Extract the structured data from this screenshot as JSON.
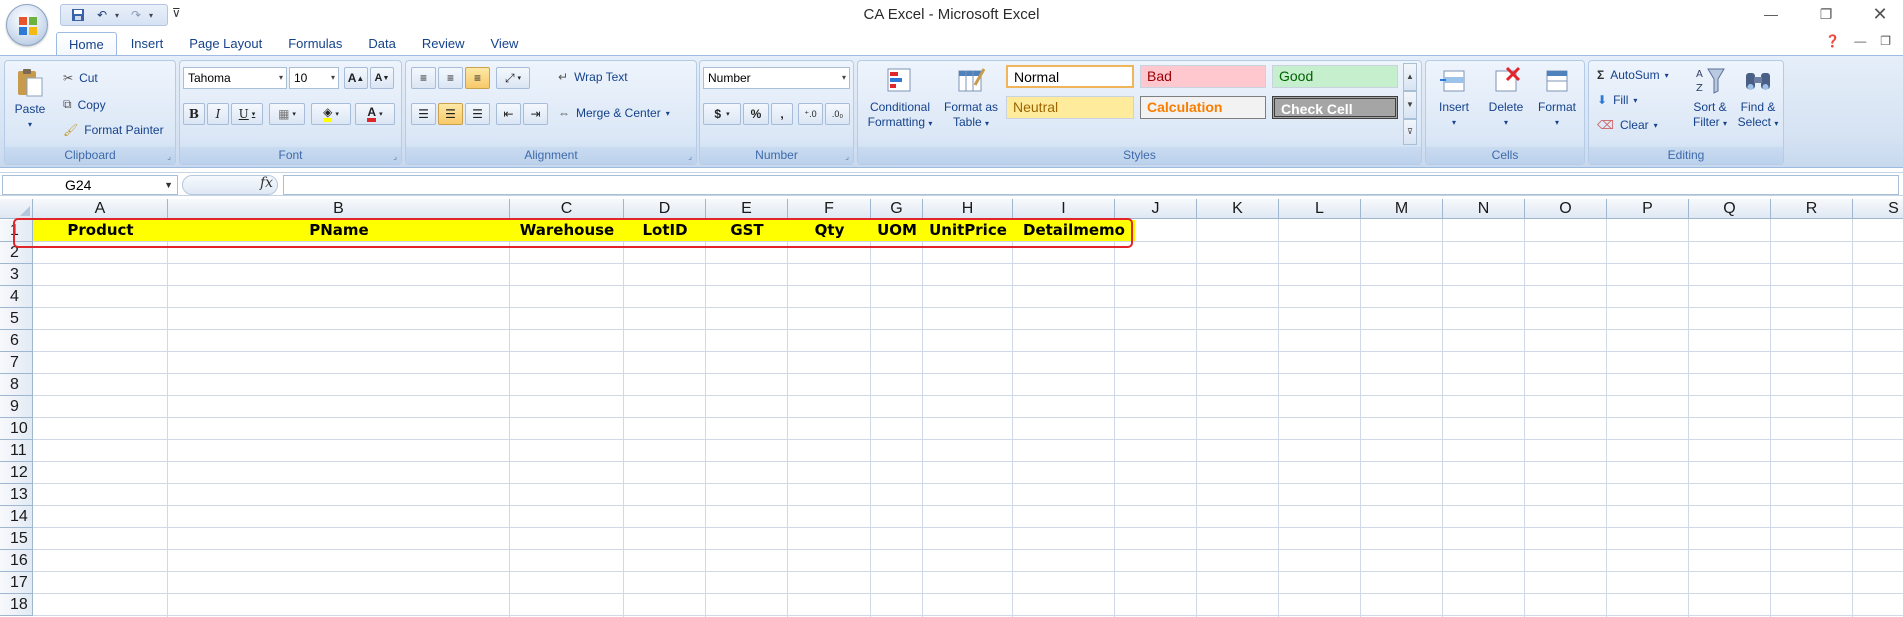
{
  "window": {
    "title": "CA Excel - Microsoft Excel"
  },
  "tabs": [
    "Home",
    "Insert",
    "Page Layout",
    "Formulas",
    "Data",
    "Review",
    "View"
  ],
  "active_tab": "Home",
  "clipboard": {
    "paste": "Paste",
    "cut": "Cut",
    "copy": "Copy",
    "format_painter": "Format Painter",
    "label": "Clipboard"
  },
  "font": {
    "name": "Tahoma",
    "size": "10",
    "label": "Font",
    "bold": "B",
    "italic": "I",
    "underline": "U",
    "grow": "A",
    "shrink": "A"
  },
  "alignment": {
    "wrap_text": "Wrap Text",
    "merge_center": "Merge & Center",
    "label": "Alignment"
  },
  "number": {
    "format": "Number",
    "label": "Number",
    "currency": "$",
    "percent": "%",
    "comma": ",",
    "inc_decimal": "+.0\n.00",
    "dec_decimal": ".00\n→.0"
  },
  "styles": {
    "conditional_formatting": "Conditional Formatting",
    "cf_line1": "Conditional",
    "cf_line2": "Formatting",
    "fat_line1": "Format as",
    "fat_line2": "Table",
    "cells": [
      "Normal",
      "Bad",
      "Good",
      "Neutral",
      "Calculation",
      "Check Cell"
    ],
    "label": "Styles"
  },
  "cells_group": {
    "insert": "Insert",
    "delete": "Delete",
    "format": "Format",
    "label": "Cells"
  },
  "editing": {
    "autosum": "AutoSum",
    "fill": "Fill",
    "clear": "Clear",
    "sort_line1": "Sort &",
    "sort_line2": "Filter",
    "find_line1": "Find &",
    "find_line2": "Select",
    "label": "Editing"
  },
  "formula_bar": {
    "name_box": "G24",
    "fx": "fx",
    "formula": ""
  },
  "columns": [
    "A",
    "B",
    "C",
    "D",
    "E",
    "F",
    "G",
    "H",
    "I",
    "J",
    "K",
    "L",
    "M",
    "N",
    "O",
    "P",
    "Q",
    "R",
    "S"
  ],
  "rows": [
    "1",
    "2",
    "3",
    "4",
    "5",
    "6",
    "7",
    "8",
    "9",
    "10",
    "11",
    "12",
    "13",
    "14",
    "15",
    "16",
    "17",
    "18"
  ],
  "header_row": [
    "Product",
    "PName",
    "Warehouse",
    "LotID",
    "GST",
    "Qty",
    "UOM",
    "UnitPrice",
    "Detailmemo"
  ],
  "colors": {
    "header_fill": "#ffff00",
    "highlight_border": "#e0252b",
    "ribbon_text": "#15428b"
  }
}
